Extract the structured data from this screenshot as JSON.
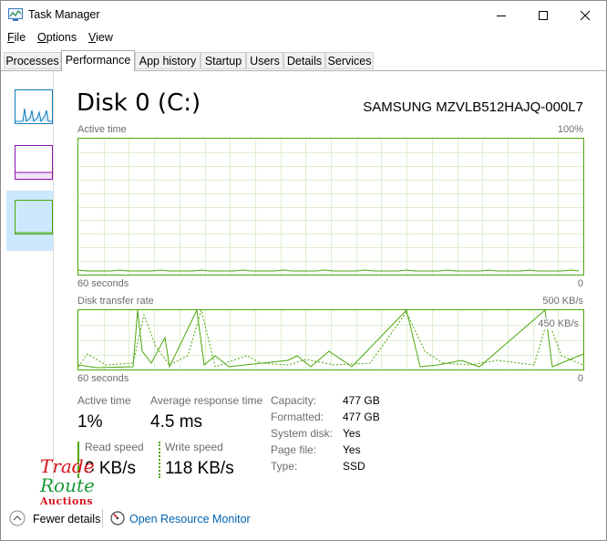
{
  "window": {
    "title": "Task Manager"
  },
  "menu": {
    "file": "File",
    "options": "Options",
    "view": "View"
  },
  "tabs": [
    "Processes",
    "Performance",
    "App history",
    "Startup",
    "Users",
    "Details",
    "Services"
  ],
  "active_tab": "Performance",
  "disk": {
    "title": "Disk 0 (C:)",
    "model": "SAMSUNG MZVLB512HAJQ-000L7"
  },
  "graph1": {
    "label": "Active time",
    "max_label": "100%",
    "time_label": "60 seconds",
    "min_label": "0"
  },
  "graph2": {
    "label": "Disk transfer rate",
    "max_label": "500 KB/s",
    "mid_label": "450 KB/s",
    "time_label": "60 seconds",
    "min_label": "0"
  },
  "stats": {
    "active_time_label": "Active time",
    "active_time_value": "1%",
    "avg_response_label": "Average response time",
    "avg_response_value": "4.5 ms",
    "read_label": "Read speed",
    "read_value": "0 KB/s",
    "write_label": "Write speed",
    "write_value": "118 KB/s"
  },
  "properties": [
    {
      "label": "Capacity:",
      "value": "477 GB"
    },
    {
      "label": "Formatted:",
      "value": "477 GB"
    },
    {
      "label": "System disk:",
      "value": "Yes"
    },
    {
      "label": "Page file:",
      "value": "Yes"
    },
    {
      "label": "Type:",
      "value": "SSD"
    }
  ],
  "watermark": {
    "line1": "Trade",
    "line2": "Route",
    "line3": "Auctions"
  },
  "footer": {
    "fewer_details": "Fewer details",
    "resource_monitor": "Open Resource Monitor"
  },
  "colors": {
    "disk_green": "#4ca60c",
    "cpu_blue": "#117dbb",
    "memory_purple": "#8b12ae",
    "link_blue": "#0063b1",
    "selected_bg": "#cce8ff"
  }
}
